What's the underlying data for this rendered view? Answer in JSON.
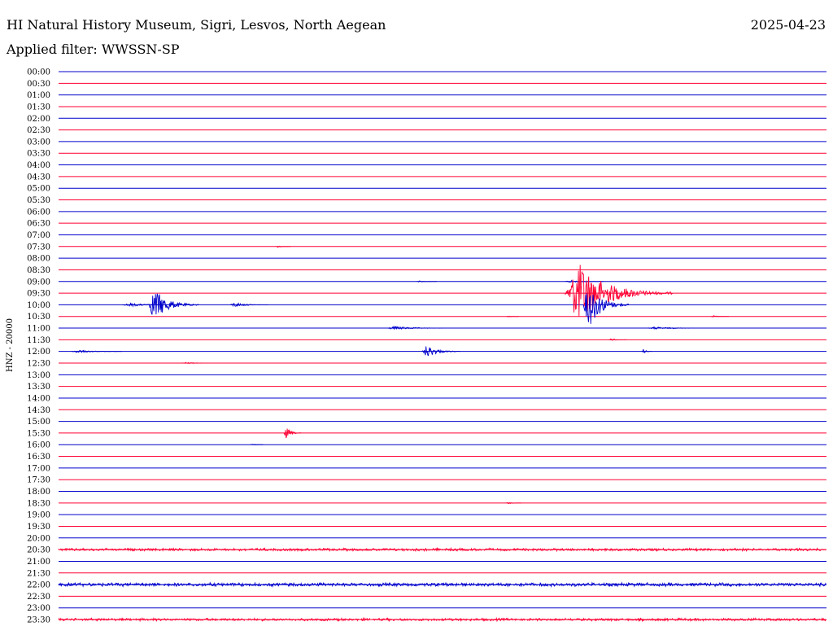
{
  "header": {
    "station": "HI Natural History Museum, Sigri, Lesvos, North Aegean",
    "date": "2025-04-23",
    "filter_label": "Applied filter: WWSSN-SP"
  },
  "chart_data": {
    "type": "line",
    "title": "HI Natural History Museum, Sigri, Lesvos, North Aegean",
    "subtitle": "Applied filter: WWSSN-SP",
    "ylabel": "HNZ - 20000",
    "xlabel": "",
    "row_labels": [
      "00:00",
      "00:30",
      "01:00",
      "01:30",
      "02:00",
      "02:30",
      "03:00",
      "03:30",
      "04:00",
      "04:30",
      "05:00",
      "05:30",
      "06:00",
      "06:30",
      "07:00",
      "07:30",
      "08:00",
      "08:30",
      "09:00",
      "09:30",
      "10:00",
      "10:30",
      "11:00",
      "11:30",
      "12:00",
      "12:30",
      "13:00",
      "13:30",
      "14:00",
      "14:30",
      "15:00",
      "15:30",
      "16:00",
      "16:30",
      "17:00",
      "17:30",
      "18:00",
      "18:30",
      "19:00",
      "19:30",
      "20:00",
      "20:30",
      "21:00",
      "21:30",
      "22:00",
      "22:30",
      "23:00",
      "23:30"
    ],
    "minutes_per_row": 30,
    "trace_colors": [
      "#0000cc",
      "#ff0033"
    ],
    "grid": false,
    "legend": "none",
    "events": [
      {
        "row": "07:30",
        "minute": 8.5,
        "duration_min": 0.6,
        "amplitude": 1
      },
      {
        "row": "09:00",
        "minute": 14,
        "duration_min": 0.8,
        "amplitude": 1
      },
      {
        "row": "09:00",
        "minute": 19.8,
        "duration_min": 1.5,
        "amplitude": 1.5
      },
      {
        "row": "09:30",
        "minute": 19.8,
        "duration_min": 4.2,
        "amplitude": 38
      },
      {
        "row": "10:00",
        "minute": 2.5,
        "duration_min": 2.5,
        "amplitude": 2
      },
      {
        "row": "10:00",
        "minute": 3.5,
        "duration_min": 2.0,
        "amplitude": 20
      },
      {
        "row": "10:00",
        "minute": 6.7,
        "duration_min": 1.5,
        "amplitude": 3
      },
      {
        "row": "10:00",
        "minute": 20.5,
        "duration_min": 1.8,
        "amplitude": 30
      },
      {
        "row": "10:30",
        "minute": 17.5,
        "duration_min": 0.5,
        "amplitude": 1
      },
      {
        "row": "10:30",
        "minute": 25.5,
        "duration_min": 0.7,
        "amplitude": 1
      },
      {
        "row": "11:00",
        "minute": 12.8,
        "duration_min": 2.8,
        "amplitude": 2
      },
      {
        "row": "11:00",
        "minute": 23,
        "duration_min": 2.5,
        "amplitude": 1.5
      },
      {
        "row": "11:30",
        "minute": 21.5,
        "duration_min": 0.7,
        "amplitude": 1.5
      },
      {
        "row": "12:00",
        "minute": 0.5,
        "duration_min": 2.0,
        "amplitude": 2
      },
      {
        "row": "12:00",
        "minute": 14.2,
        "duration_min": 1.5,
        "amplitude": 8
      },
      {
        "row": "12:00",
        "minute": 22.8,
        "duration_min": 0.4,
        "amplitude": 3
      },
      {
        "row": "12:30",
        "minute": 4.8,
        "duration_min": 1.5,
        "amplitude": 1
      },
      {
        "row": "15:30",
        "minute": 8.8,
        "duration_min": 0.7,
        "amplitude": 8
      },
      {
        "row": "16:00",
        "minute": 7.5,
        "duration_min": 0.5,
        "amplitude": 1
      },
      {
        "row": "18:30",
        "minute": 17.5,
        "duration_min": 0.6,
        "amplitude": 1
      },
      {
        "row": "20:30",
        "minute": 0,
        "duration_min": 30,
        "amplitude": 1.5
      },
      {
        "row": "22:00",
        "minute": 0,
        "duration_min": 30,
        "amplitude": 2
      },
      {
        "row": "23:30",
        "minute": 0,
        "duration_min": 30,
        "amplitude": 1.5
      }
    ]
  }
}
